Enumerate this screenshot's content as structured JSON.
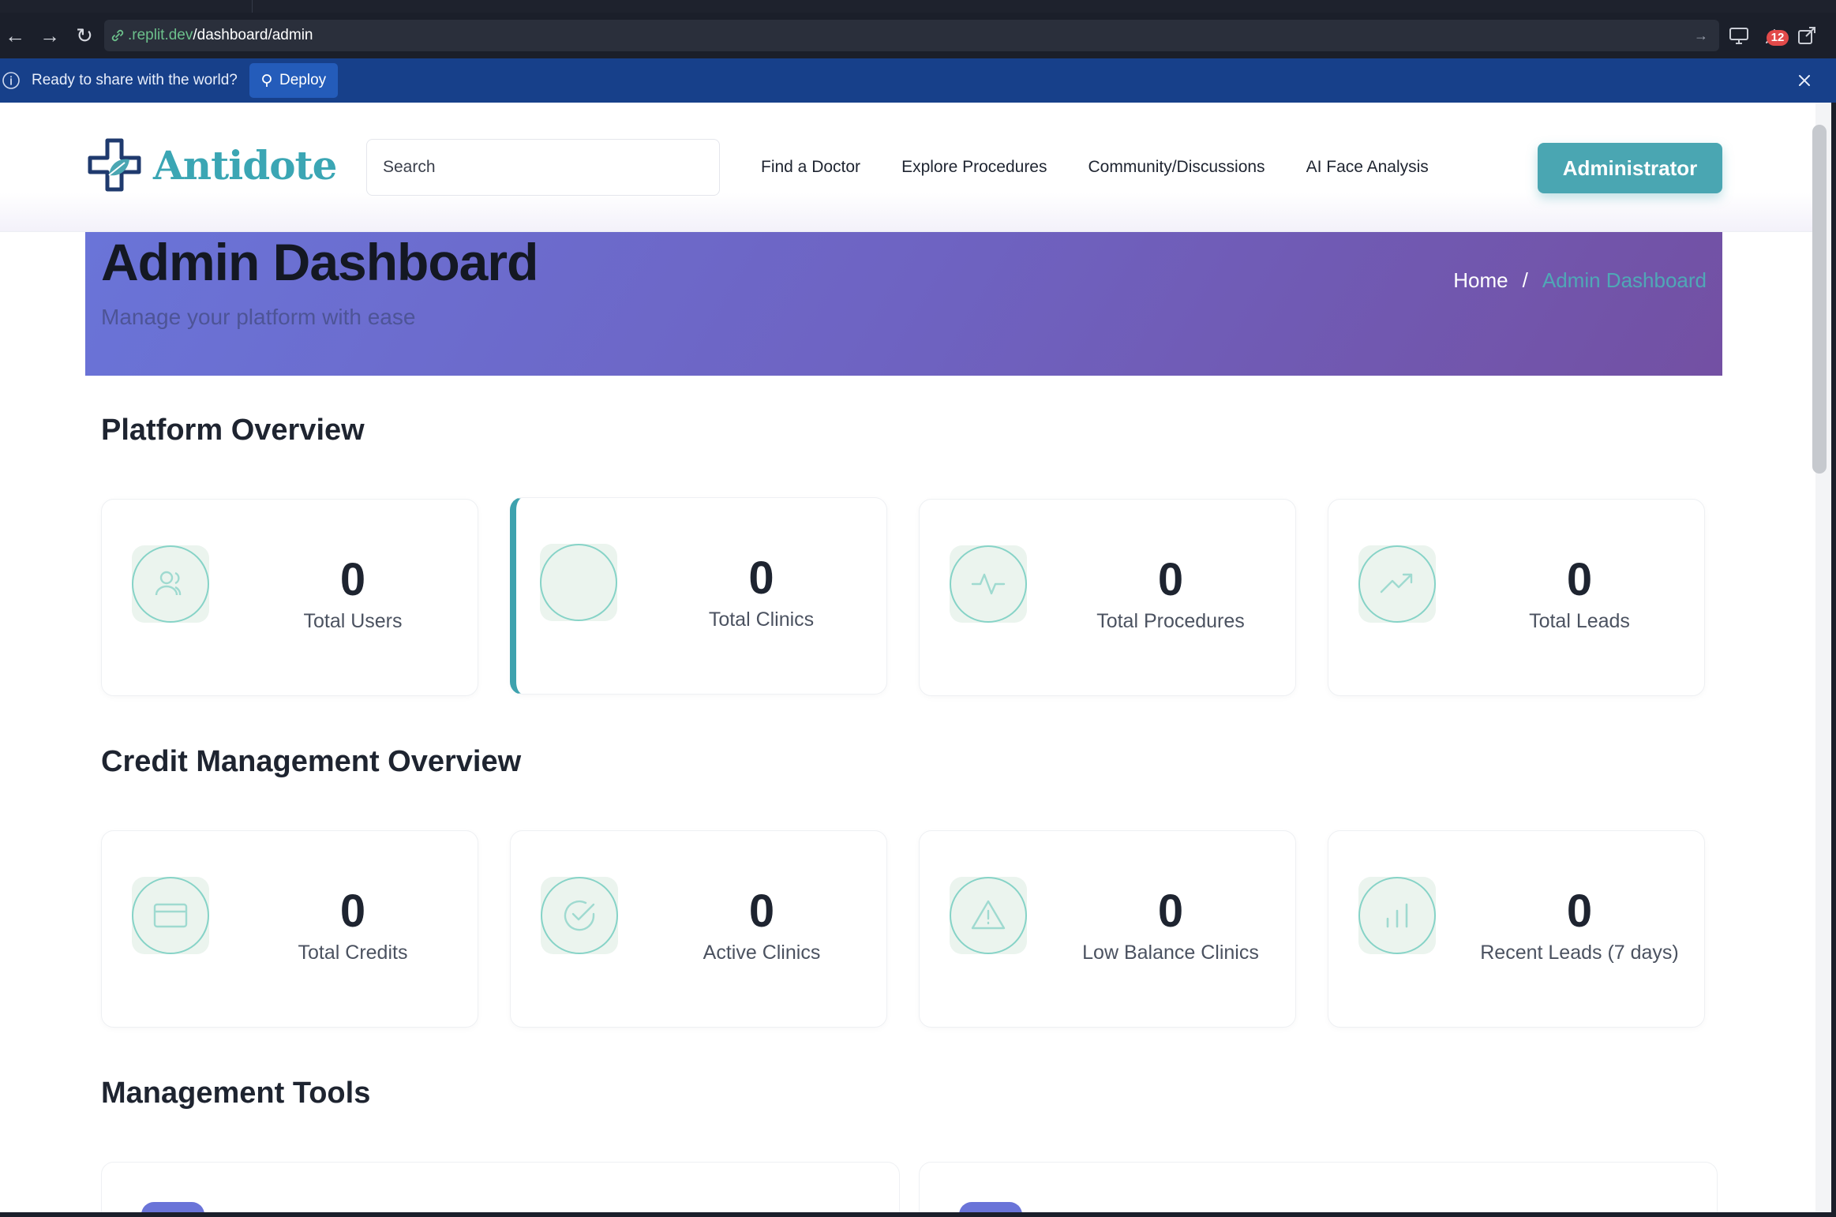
{
  "browser": {
    "url_host": ".replit.dev",
    "url_path": "/dashboard/admin",
    "badge_count": "12"
  },
  "deploy_bar": {
    "message": "Ready to share with the world?",
    "button_label": "Deploy"
  },
  "header": {
    "logo_text": "Antidote",
    "search_placeholder": "Search",
    "nav": [
      "Find a Doctor",
      "Explore Procedures",
      "Community/Discussions",
      "AI Face Analysis"
    ],
    "user_button": "Administrator"
  },
  "hero": {
    "title": "Admin Dashboard",
    "subtitle": "Manage your platform with ease",
    "breadcrumb_home": "Home",
    "breadcrumb_sep": "/",
    "breadcrumb_current": "Admin Dashboard"
  },
  "platform_overview": {
    "title": "Platform Overview",
    "cards": [
      {
        "value": "0",
        "label": "Total Users",
        "icon": "users-icon"
      },
      {
        "value": "0",
        "label": "Total Clinics",
        "icon": "clinic-icon"
      },
      {
        "value": "0",
        "label": "Total Procedures",
        "icon": "activity-icon"
      },
      {
        "value": "0",
        "label": "Total Leads",
        "icon": "trending-up-icon"
      }
    ]
  },
  "credit_overview": {
    "title": "Credit Management Overview",
    "cards": [
      {
        "value": "0",
        "label": "Total Credits",
        "icon": "credit-card-icon"
      },
      {
        "value": "0",
        "label": "Active Clinics",
        "icon": "check-circle-icon"
      },
      {
        "value": "0",
        "label": "Low Balance Clinics",
        "icon": "alert-triangle-icon"
      },
      {
        "value": "0",
        "label": "Recent Leads (7 days)",
        "icon": "bar-chart-icon"
      }
    ]
  },
  "management_tools": {
    "title": "Management Tools"
  },
  "colors": {
    "accent": "#4aa6b2",
    "deploy_bar": "#17408a",
    "hero_start": "#6a74d8",
    "hero_end": "#7350a3"
  }
}
